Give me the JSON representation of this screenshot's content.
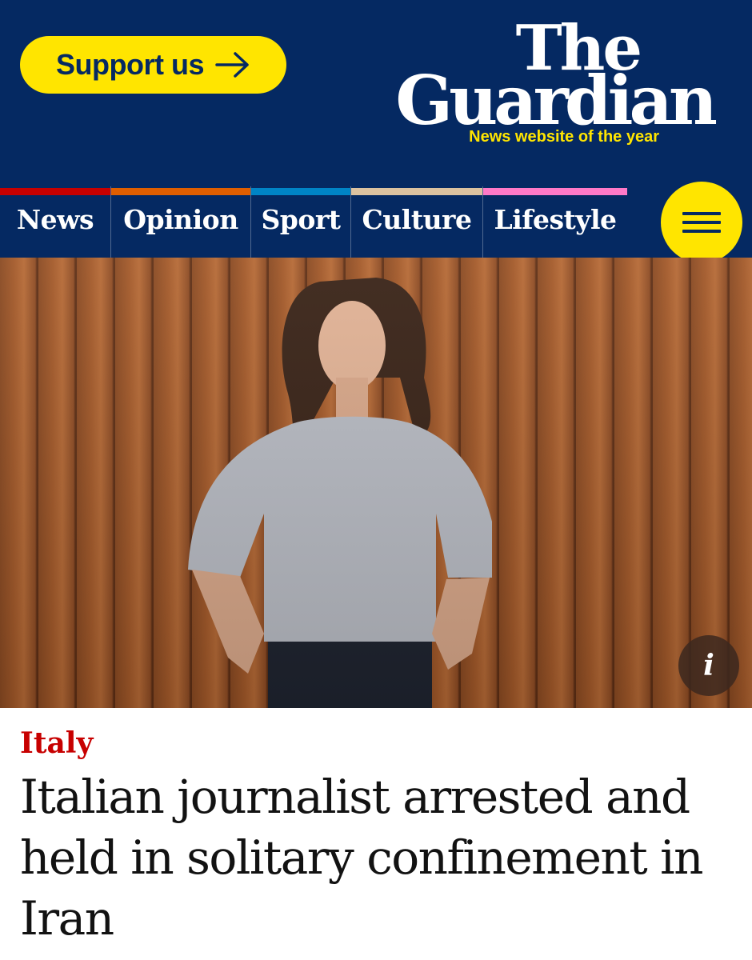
{
  "header": {
    "support_label": "Support us",
    "logo_the": "The",
    "logo_guardian": "Guardian",
    "tagline": "News website of the year"
  },
  "nav": {
    "items": [
      {
        "label": "News",
        "color": "#c70000"
      },
      {
        "label": "Opinion",
        "color": "#e05e00"
      },
      {
        "label": "Sport",
        "color": "#0084c6"
      },
      {
        "label": "Culture",
        "color": "#dcc2a0"
      },
      {
        "label": "Lifestyle",
        "color": "#ff79c7"
      }
    ],
    "menu_icon": "hamburger-menu-icon"
  },
  "photo": {
    "info_glyph": "i"
  },
  "article": {
    "kicker": "Italy",
    "headline": "Italian journalist arrested and held in solitary confinement in Iran"
  },
  "colors": {
    "brand_blue": "#052962",
    "accent_yellow": "#ffe500",
    "kicker_red": "#c70000"
  }
}
